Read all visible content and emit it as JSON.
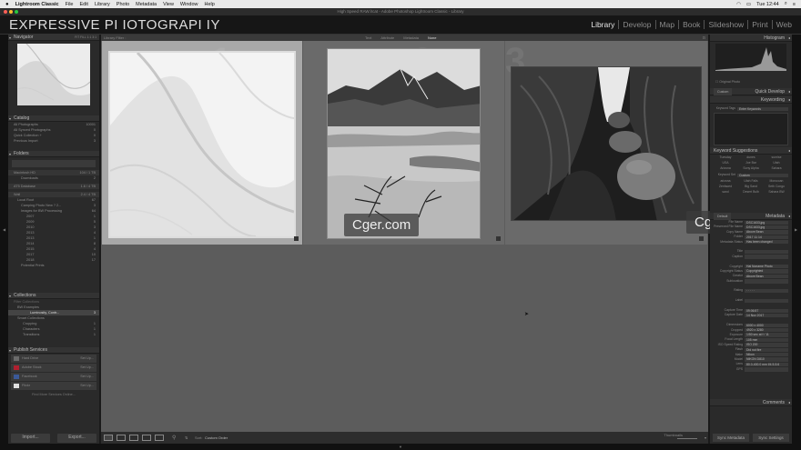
{
  "menubar": {
    "items": [
      "Lightroom Classic",
      "File",
      "Edit",
      "Library",
      "Photo",
      "Metadata",
      "View",
      "Window",
      "Help"
    ],
    "clock": "Tue 12:44"
  },
  "window_title": "High Speed RAW.lrcat - Adobe Photoshop Lightroom Classic - Library",
  "identity_plate": "EXPRESSIVE PI IOTOGRAPI IY",
  "modules": [
    "Library",
    "Develop",
    "Map",
    "Book",
    "Slideshow",
    "Print",
    "Web"
  ],
  "left": {
    "navigator": {
      "title": "Navigator",
      "zoom": "FIT  FILL  1:1  3:1"
    },
    "catalog": {
      "title": "Catalog",
      "rows": [
        {
          "label": "All Photographs",
          "count": "10001"
        },
        {
          "label": "All Synced Photographs",
          "count": "0"
        },
        {
          "label": "Quick Collection +",
          "count": "0"
        },
        {
          "label": "Previous Import",
          "count": "3"
        }
      ]
    },
    "folders": {
      "title": "Folders",
      "rows": [
        {
          "label": "Macintosh HD",
          "count": "104 / 1 TB"
        },
        {
          "label": "Downloads",
          "count": "2"
        },
        {
          "label": "AT5 Database",
          "count": "1.6 / 4 TB"
        },
        {
          "label": "Wall",
          "count": "2.4 / 4 TB"
        },
        {
          "label": "Local Root",
          "count": "67"
        },
        {
          "label": "Camping Photo New ? 2...",
          "count": "3"
        },
        {
          "label": "Images for BW Processing",
          "count": "64"
        },
        {
          "label": "2007",
          "count": "1"
        },
        {
          "label": "2009",
          "count": "5"
        },
        {
          "label": "2010",
          "count": "3"
        },
        {
          "label": "2013",
          "count": "4"
        },
        {
          "label": "2013",
          "count": "1"
        },
        {
          "label": "2014",
          "count": "8"
        },
        {
          "label": "2015",
          "count": "4"
        },
        {
          "label": "2017",
          "count": "10"
        },
        {
          "label": "2018",
          "count": "17"
        },
        {
          "label": "Potential Prints",
          "count": ""
        }
      ]
    },
    "collections": {
      "title": "Collections",
      "rows": [
        {
          "label": "Filter Collections",
          "count": ""
        },
        {
          "label": "BW Examples",
          "count": ""
        },
        {
          "label": "Luminosity, Contr...",
          "count": "3"
        },
        {
          "label": "Smart Collections",
          "count": ""
        },
        {
          "label": "Cropping",
          "count": "1"
        },
        {
          "label": "Characters",
          "count": "1"
        },
        {
          "label": "Transitions",
          "count": "1"
        }
      ]
    },
    "publish": {
      "title": "Publish Services",
      "rows": [
        {
          "label": "Hard Drive",
          "setup": "Set Up...",
          "color": "#6a6a6a"
        },
        {
          "label": "Adobe Stock",
          "setup": "Set Up...",
          "color": "#b02030"
        },
        {
          "label": "Facebook",
          "setup": "Set Up...",
          "color": "#3b5998"
        },
        {
          "label": "Flickr",
          "setup": "Set Up...",
          "color": "#e0e0e0"
        }
      ],
      "find_more": "Find More Services Online..."
    },
    "import_label": "Import...",
    "export_label": "Export..."
  },
  "filterbar": {
    "label": "Library Filter :",
    "options": [
      "Text",
      "Attribute",
      "Metadata",
      "None"
    ],
    "active": "None"
  },
  "cells": [
    "1",
    "2",
    "3"
  ],
  "watermark": "Cger.com",
  "toolbar": {
    "sort_label": "Sort:",
    "sort_value": "Custom Order",
    "thumbnails_label": "Thumbnails"
  },
  "right": {
    "histogram": {
      "title": "Histogram",
      "original": "Original Photo"
    },
    "quick_develop": {
      "preset": "Custom",
      "title": "Quick Develop"
    },
    "keywording": {
      "title": "Keywording",
      "tags_label": "Keyword Tags",
      "tags_value": "Enter Keywords"
    },
    "keyword_suggestions": {
      "title": "Keyword Suggestions",
      "items": [
        "Tuesday",
        "dunes",
        "sunrise",
        "USA",
        "Joe Bar",
        "Utah",
        "Arizona",
        "Sony Alpha",
        "Sahara"
      ]
    },
    "keyword_set": {
      "label": "Keyword Set",
      "value": "Custom",
      "items": [
        "arizona",
        "Utah Falls",
        "Moroccan",
        "Zenfaced",
        "Big Sand",
        "Seth Congo",
        "sand",
        "Desert Bulb",
        "Sahara BW"
      ]
    },
    "metadata_title": "Metadata",
    "metadata_preset": "Default",
    "metadata": [
      {
        "k": "File Name",
        "v": "DSC1633.jpg"
      },
      {
        "k": "Preserved File Name",
        "v": "DSC1633.jpg"
      },
      {
        "k": "Copy Name",
        "v": "Above Bean"
      },
      {
        "k": "Folder",
        "v": "2017 11 14"
      },
      {
        "k": "Metadata Status",
        "v": "Has been changed"
      },
      {
        "k": "",
        "v": ""
      },
      {
        "k": "Title",
        "v": ""
      },
      {
        "k": "Caption",
        "v": ""
      },
      {
        "k": "",
        "v": ""
      },
      {
        "k": "Copyright",
        "v": "Hal Noname Photo"
      },
      {
        "k": "Copyright Status",
        "v": "Copyrighted"
      },
      {
        "k": "Creator",
        "v": "Above Bean"
      },
      {
        "k": "Sublocation",
        "v": ""
      },
      {
        "k": "",
        "v": ""
      },
      {
        "k": "Rating",
        "v": "· · · · ·"
      },
      {
        "k": "",
        "v": ""
      },
      {
        "k": "Label",
        "v": ""
      },
      {
        "k": "",
        "v": ""
      },
      {
        "k": "Capture Time",
        "v": "09:06:57"
      },
      {
        "k": "Capture Date",
        "v": "14 Nov 2017"
      },
      {
        "k": "",
        "v": ""
      },
      {
        "k": "Dimensions",
        "v": "6000 x 4000"
      },
      {
        "k": "Cropped",
        "v": "4920 x 3280"
      },
      {
        "k": "Exposure",
        "v": "1/50 sec at f / 11"
      },
      {
        "k": "Focal Length",
        "v": "105 mm"
      },
      {
        "k": "ISO Speed Rating",
        "v": "ISO 200"
      },
      {
        "k": "Flash",
        "v": "Did not fire"
      },
      {
        "k": "Make",
        "v": "Nikon"
      },
      {
        "k": "Model",
        "v": "NIKON D810"
      },
      {
        "k": "Lens",
        "v": "80.0-400.0 mm f/4.5-5.6"
      },
      {
        "k": "GPS",
        "v": ""
      }
    ],
    "comments_title": "Comments",
    "sync_metadata": "Sync Metadata",
    "sync_settings": "Sync Settings"
  }
}
